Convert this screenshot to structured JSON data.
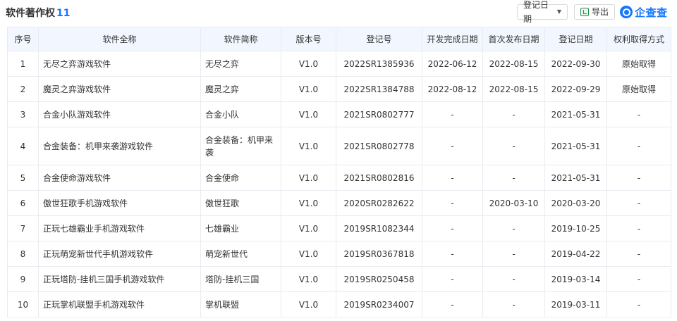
{
  "header": {
    "title": "软件著作权",
    "count": "11",
    "date_filter_label": "登记日期",
    "export_label": "导出",
    "brand": "企查查"
  },
  "table": {
    "columns": [
      "序号",
      "软件全称",
      "软件简称",
      "版本号",
      "登记号",
      "开发完成日期",
      "首次发布日期",
      "登记日期",
      "权利取得方式"
    ],
    "rows": [
      {
        "no": "1",
        "full_name": "无尽之弈游戏软件",
        "short_name": "无尽之弈",
        "version": "V1.0",
        "reg_no": "2022SR1385936",
        "dev_date": "2022-06-12",
        "pub_date": "2022-08-15",
        "reg_date": "2022-09-30",
        "method": "原始取得"
      },
      {
        "no": "2",
        "full_name": "魔灵之弈游戏软件",
        "short_name": "魔灵之弈",
        "version": "V1.0",
        "reg_no": "2022SR1384788",
        "dev_date": "2022-08-12",
        "pub_date": "2022-08-15",
        "reg_date": "2022-09-29",
        "method": "原始取得"
      },
      {
        "no": "3",
        "full_name": "合金小队游戏软件",
        "short_name": "合金小队",
        "version": "V1.0",
        "reg_no": "2021SR0802777",
        "dev_date": "-",
        "pub_date": "-",
        "reg_date": "2021-05-31",
        "method": "-"
      },
      {
        "no": "4",
        "full_name": "合金装备：机甲来袭游戏软件",
        "short_name": "合金装备：机甲来袭",
        "version": "V1.0",
        "reg_no": "2021SR0802778",
        "dev_date": "-",
        "pub_date": "-",
        "reg_date": "2021-05-31",
        "method": "-"
      },
      {
        "no": "5",
        "full_name": "合金使命游戏软件",
        "short_name": "合金使命",
        "version": "V1.0",
        "reg_no": "2021SR0802816",
        "dev_date": "-",
        "pub_date": "-",
        "reg_date": "2021-05-31",
        "method": "-"
      },
      {
        "no": "6",
        "full_name": "傲世狂歌手机游戏软件",
        "short_name": "傲世狂歌",
        "version": "V1.0",
        "reg_no": "2020SR0282622",
        "dev_date": "-",
        "pub_date": "2020-03-10",
        "reg_date": "2020-03-20",
        "method": "-"
      },
      {
        "no": "7",
        "full_name": "正玩七雄霸业手机游戏软件",
        "short_name": "七雄霸业",
        "version": "V1.0",
        "reg_no": "2019SR1082344",
        "dev_date": "-",
        "pub_date": "-",
        "reg_date": "2019-10-25",
        "method": "-"
      },
      {
        "no": "8",
        "full_name": "正玩萌宠新世代手机游戏软件",
        "short_name": "萌宠新世代",
        "version": "V1.0",
        "reg_no": "2019SR0367818",
        "dev_date": "-",
        "pub_date": "-",
        "reg_date": "2019-04-22",
        "method": "-"
      },
      {
        "no": "9",
        "full_name": "正玩塔防-挂机三国手机游戏软件",
        "short_name": "塔防-挂机三国",
        "version": "V1.0",
        "reg_no": "2019SR0250458",
        "dev_date": "-",
        "pub_date": "-",
        "reg_date": "2019-03-14",
        "method": "-"
      },
      {
        "no": "10",
        "full_name": "正玩掌机联盟手机游戏软件",
        "short_name": "掌机联盟",
        "version": "V1.0",
        "reg_no": "2019SR0234007",
        "dev_date": "-",
        "pub_date": "-",
        "reg_date": "2019-03-11",
        "method": "-"
      }
    ]
  }
}
